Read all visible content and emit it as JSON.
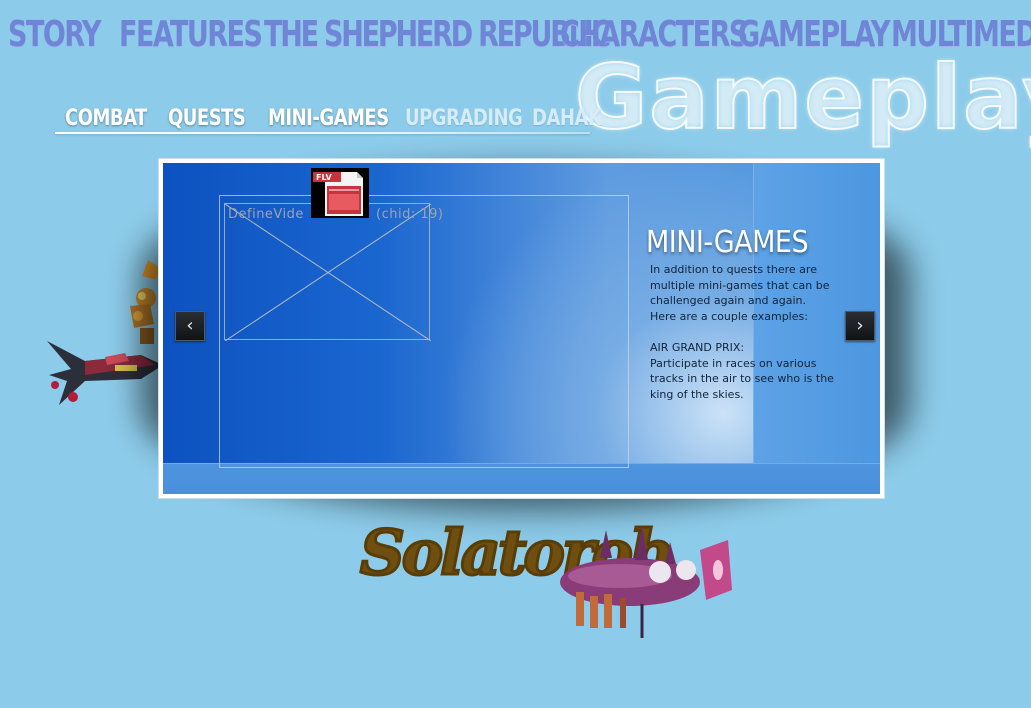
{
  "nav": {
    "story": "Story",
    "features": "Features",
    "republic": "The Shepherd Republic",
    "characters": "Characters",
    "gameplay": "Gameplay",
    "multimedia": "Multimedia"
  },
  "page_title": "Gameplay",
  "subnav": {
    "combat": "Combat",
    "quests": "Quests",
    "mini_games": "Mini-Games",
    "upgrading": "Upgrading Dahak"
  },
  "slide": {
    "video_label": "DefineVide",
    "video_id": "(chid: 19)",
    "flv_label": "FLV",
    "heading": "MINI-GAMES",
    "paragraphs": [
      "In addition to quests there are multiple mini-games that can be challenged again and again.",
      "Here are a couple examples:",
      "",
      "AIR GRAND PRIX:",
      "Participate in races on various tracks in the air to see who is the king of the skies."
    ]
  },
  "arrows": {
    "prev": "‹",
    "next": "›"
  },
  "logo_text": "Solatorob",
  "colors": {
    "background": "#8ccbe9",
    "nav": "#6f86d6",
    "slide_blue": "#1a66cf"
  }
}
